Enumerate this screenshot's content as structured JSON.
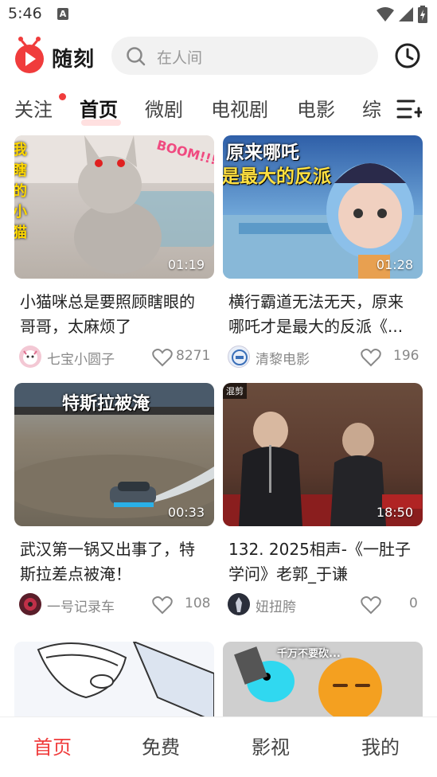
{
  "status": {
    "time": "5:46",
    "notification_icon": "A"
  },
  "app": {
    "logo_text": "随刻",
    "brand_color": "#f03c3c"
  },
  "search": {
    "placeholder": "在人间"
  },
  "tabs": [
    {
      "label": "关注",
      "has_dot": true
    },
    {
      "label": "首页",
      "active": true
    },
    {
      "label": "微剧"
    },
    {
      "label": "电视剧"
    },
    {
      "label": "电影"
    },
    {
      "label": "综"
    }
  ],
  "videos": [
    {
      "duration": "01:19",
      "title": "小猫咪总是要照顾瞎眼的哥哥，太麻烦了",
      "author": "七宝小圆子",
      "likes": "8271",
      "overlay_text": "BOOM!!!",
      "side_text": "我 瞎 的 小 猫"
    },
    {
      "duration": "01:28",
      "title": "横行霸道无法无天，原来哪吒才是最大的反派《...",
      "author": "清黎电影",
      "likes": "196",
      "overlay_line1": "原来哪吒",
      "overlay_line2": "是最大的反派"
    },
    {
      "duration": "00:33",
      "title": "武汉第一锅又出事了，特斯拉差点被淹！",
      "author": "一号记录车",
      "likes": "108",
      "overlay_text": "特斯拉被淹"
    },
    {
      "duration": "18:50",
      "title": "132. 2025相声-《一肚子学问》老郭_于谦",
      "author": "妞扭胯",
      "likes": "0",
      "tag": "混剪"
    },
    {
      "duration": "",
      "title": "",
      "author": "",
      "likes": ""
    },
    {
      "duration": "",
      "title": "",
      "author": "",
      "likes": "",
      "overlay_text": "千万不要砍..."
    }
  ],
  "bottom_nav": [
    {
      "label": "首页",
      "active": true
    },
    {
      "label": "免费"
    },
    {
      "label": "影视"
    },
    {
      "label": "我的"
    }
  ]
}
